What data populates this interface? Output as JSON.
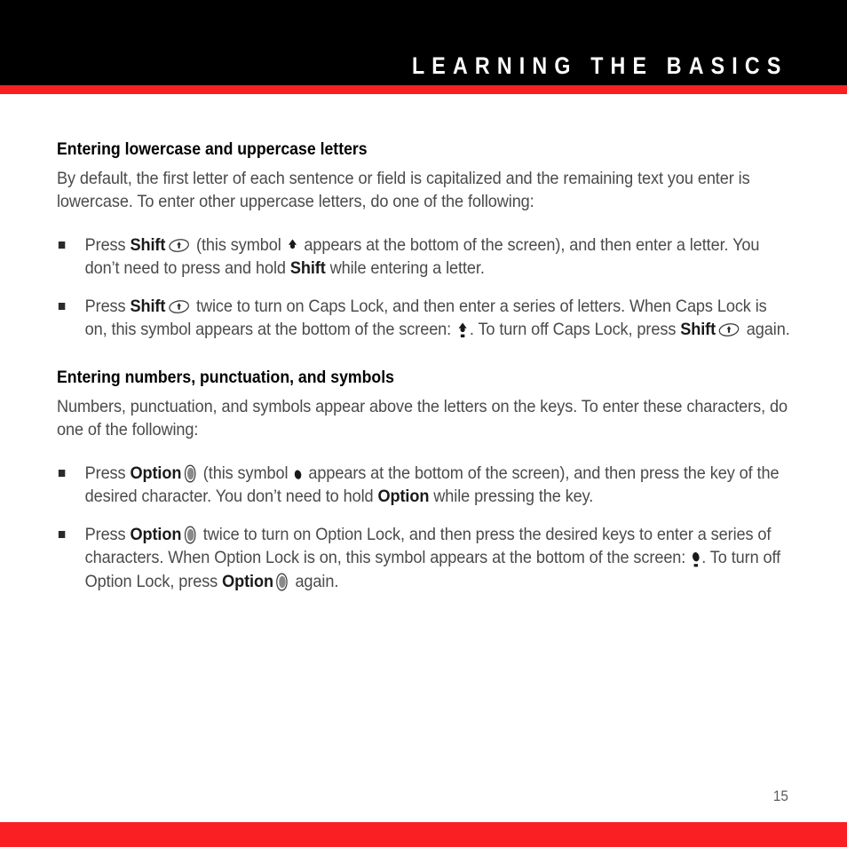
{
  "header": {
    "title": "LEARNING THE BASICS",
    "band_color": "#000000",
    "rule_color": "#FA1F22"
  },
  "footer": {
    "page_number": "15",
    "rule_color": "#FA1F22"
  },
  "colors": {
    "accent_red": "#FA1F22",
    "heading_text": "#000000",
    "body_text": "#4a4a4a",
    "bold_text": "#1a1a1a",
    "page_number_text": "#5b5b5b"
  },
  "icons": {
    "bullet": "square-bullet",
    "shift_key": "shift-key-icon",
    "option_key": "option-key-icon",
    "shift_symbol": "shift-arrow-symbol",
    "caps_lock_symbol": "caps-lock-arrow-underline-symbol",
    "option_symbol": "option-dot-symbol",
    "option_lock_symbol": "option-dot-underline-symbol"
  },
  "sections": [
    {
      "heading": "Entering lowercase and uppercase letters",
      "paragraph": "By default, the first letter of each sentence or field is capitalized and the remaining text you enter is lowercase. To enter other uppercase letters, do one of the following:",
      "bullets": [
        {
          "p1": "Press ",
          "b1": "Shift",
          "p2": " (this symbol ",
          "p3": " appears at the bottom of the screen), and then enter a letter. You don’t need to press and hold ",
          "b2": "Shift",
          "p4": " while entering a letter."
        },
        {
          "p1": "Press ",
          "b1": "Shift",
          "p2": " twice to turn on Caps Lock, and then enter a series of letters. When Caps Lock is on, this symbol appears at the bottom of the screen: ",
          "p3": ". To turn off Caps Lock, press ",
          "b2": "Shift",
          "p4": " again."
        }
      ]
    },
    {
      "heading": "Entering numbers, punctuation, and symbols",
      "paragraph": "Numbers, punctuation, and symbols appear above the letters on the keys. To enter these characters, do one of the following:",
      "bullets": [
        {
          "p1": "Press ",
          "b1": "Option",
          "p2": " (this symbol ",
          "p3": " appears at the bottom of the screen), and then press the key of the desired character. You don’t need to hold ",
          "b2": "Option",
          "p4": " while pressing the key."
        },
        {
          "p1": "Press ",
          "b1": "Option",
          "p2": " twice to turn on Option Lock, and then press the desired keys to enter a series of characters. When Option Lock is on, this symbol appears at the bottom of the screen: ",
          "p3": ". To turn off Option Lock, press ",
          "b2": "Option",
          "p4": " again."
        }
      ]
    }
  ]
}
